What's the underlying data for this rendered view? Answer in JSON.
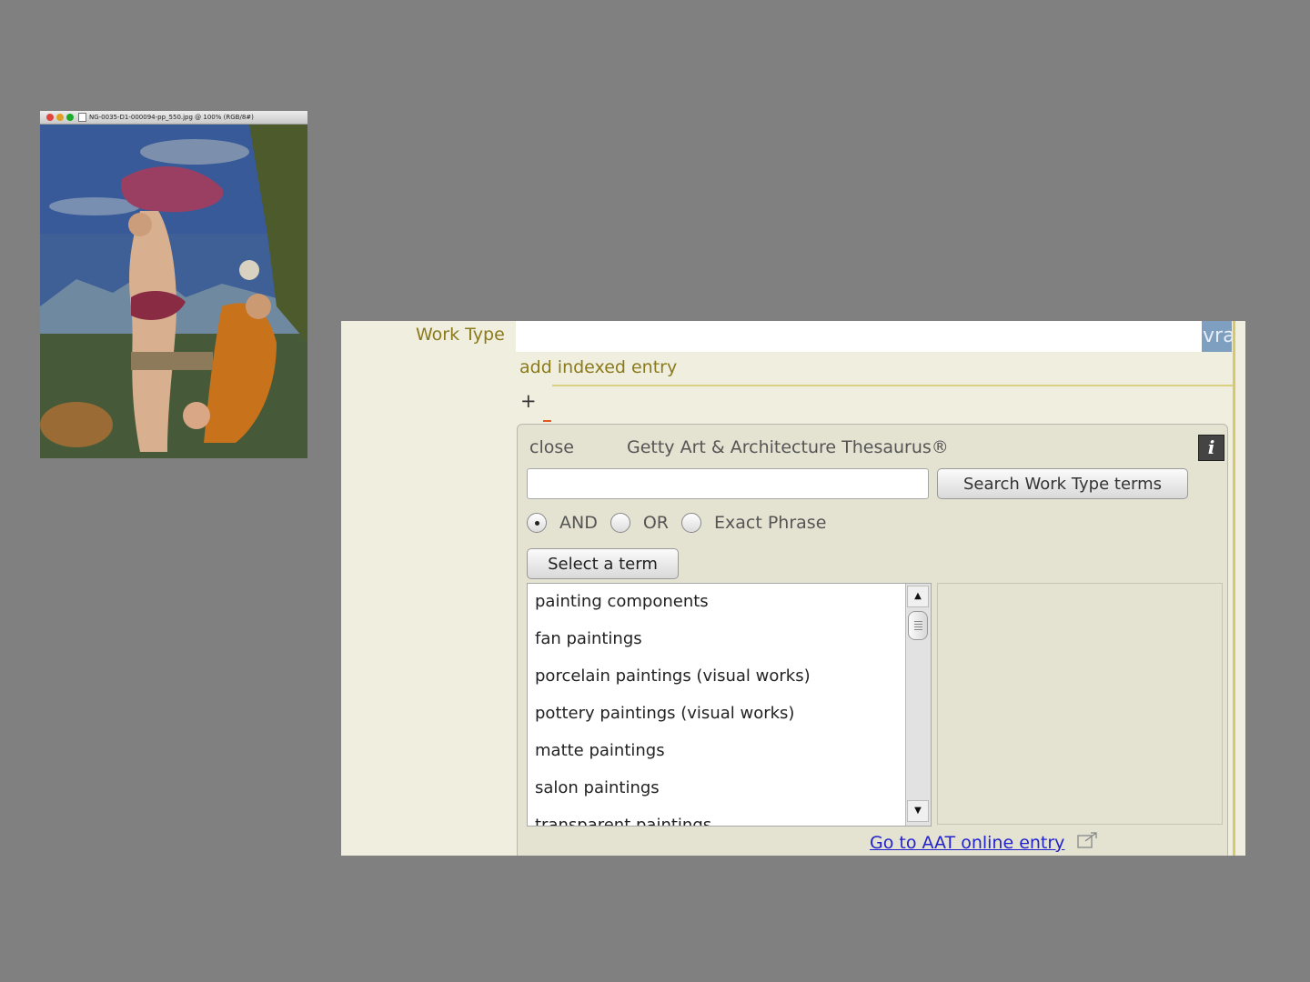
{
  "image_window": {
    "title": "NG-0035-D1-000094-pp_550.jpg @ 100% (RGB/8#)"
  },
  "form": {
    "work_type_label": "Work Type",
    "work_type_value": "",
    "vra_badge": "vra",
    "add_indexed_entry": "add indexed entry",
    "add_button": "+"
  },
  "thesaurus": {
    "close_label": "close",
    "title": "Getty Art & Architecture Thesaurus®",
    "info_label": "i",
    "search": {
      "value": "",
      "placeholder": ""
    },
    "search_button": "Search Work Type terms",
    "match_options": [
      {
        "label": "AND",
        "selected": true
      },
      {
        "label": "OR",
        "selected": false
      },
      {
        "label": "Exact Phrase",
        "selected": false
      }
    ],
    "select_term_button": "Select a term",
    "terms": [
      "painting components",
      "fan paintings",
      "porcelain paintings (visual works)",
      "pottery paintings (visual works)",
      "matte paintings",
      "salon paintings",
      "transparent paintings"
    ],
    "aat_link": "Go to AAT online entry"
  },
  "colors": {
    "background": "#808080",
    "panel": "#efeedf",
    "label_olive": "#8b7a1c",
    "link": "#2222cc",
    "vra_badge": "#7f9fc0"
  },
  "icons": [
    "window-close-icon",
    "window-minimize-icon",
    "window-zoom-icon",
    "document-icon",
    "info-icon",
    "scroll-up-arrow-icon",
    "scroll-down-arrow-icon",
    "external-link-icon"
  ]
}
